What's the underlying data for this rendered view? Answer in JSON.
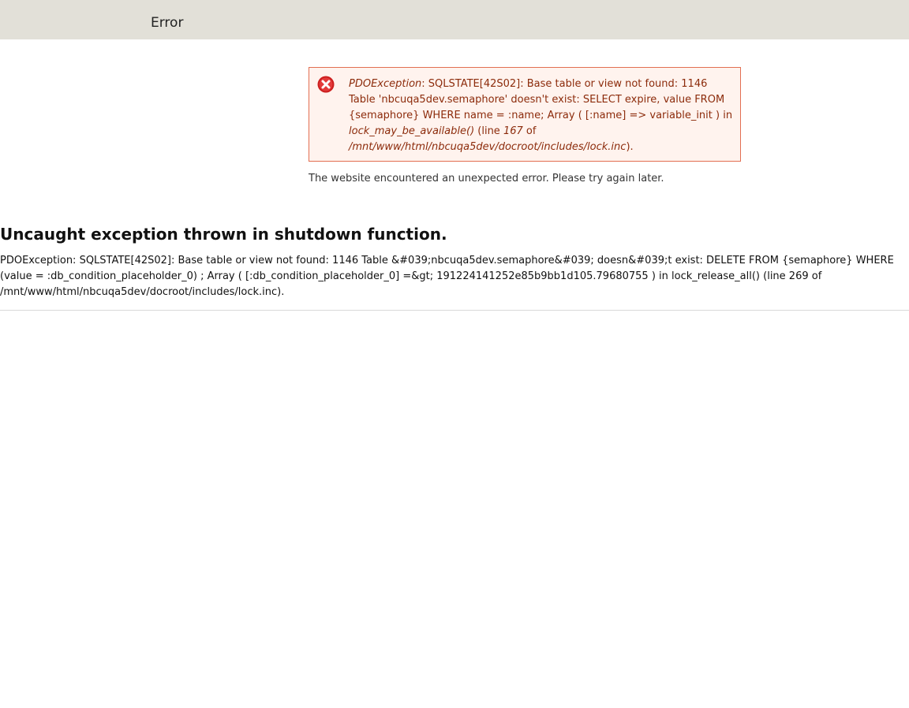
{
  "header": {
    "title": "Error"
  },
  "error_message": {
    "icon": "error-x-icon",
    "exception_class": "PDOException",
    "message_part1": ": SQLSTATE[42S02]: Base table or view not found: 1146 Table 'nbcuqa5dev.semaphore' doesn't exist: SELECT expire, value FROM {semaphore} WHERE name = :name; Array ( [:name] => variable_init ) in ",
    "function": "lock_may_be_available()",
    "line_prefix": " (line ",
    "line_number": "167",
    "of_text": " of ",
    "file_path": "/mnt/www/html/nbcuqa5dev/docroot/includes/lock.inc",
    "suffix": ")."
  },
  "error_note": "The website encountered an unexpected error. Please try again later.",
  "uncaught": {
    "title": "Uncaught exception thrown in shutdown function.",
    "text": "PDOException: SQLSTATE[42S02]: Base table or view not found: 1146 Table &#039;nbcuqa5dev.semaphore&#039; doesn&#039;t exist: DELETE FROM {semaphore} WHERE (value = :db_condition_placeholder_0) ; Array ( [:db_condition_placeholder_0] =&gt; 191224141252e85b9bb1d105.79680755 ) in lock_release_all() (line 269 of /mnt/www/html/nbcuqa5dev/docroot/includes/lock.inc)."
  },
  "colors": {
    "header_bg": "#e2e0d8",
    "error_border": "#e26f52",
    "error_bg": "#fff3ee",
    "error_text": "#8c2b0b",
    "error_icon": "#cc1f1f"
  }
}
